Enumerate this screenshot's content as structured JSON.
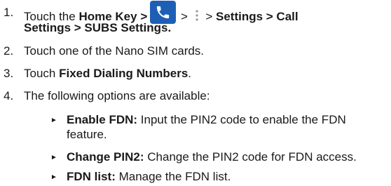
{
  "steps": [
    {
      "number": "1.",
      "parts": {
        "a": "Touch the ",
        "b": "Home Key >",
        "c": " > ",
        "d": " > ",
        "e": "Settings > Call",
        "f": "Settings > SUBS Settings."
      }
    },
    {
      "number": "2.",
      "text": "Touch one of the Nano SIM cards."
    },
    {
      "number": "3.",
      "a": "Touch ",
      "b": "Fixed Dialing Numbers",
      "c": "."
    },
    {
      "number": "4.",
      "text": "The following options are available:"
    }
  ],
  "options": [
    {
      "bullet": "►",
      "label": "Enable FDN:",
      "text": " Input the PIN2 code to enable the FDN",
      "text2": "feature."
    },
    {
      "bullet": "►",
      "label": "Change PIN2:",
      "text": " Change the PIN2 code for FDN access."
    },
    {
      "bullet": "►",
      "label": "FDN list:",
      "text": " Manage the FDN list."
    }
  ],
  "icons": {
    "phone_app": "phone-icon",
    "menu": "vertical-dots-menu-icon",
    "phone_app_color": "#1e5fb6"
  }
}
